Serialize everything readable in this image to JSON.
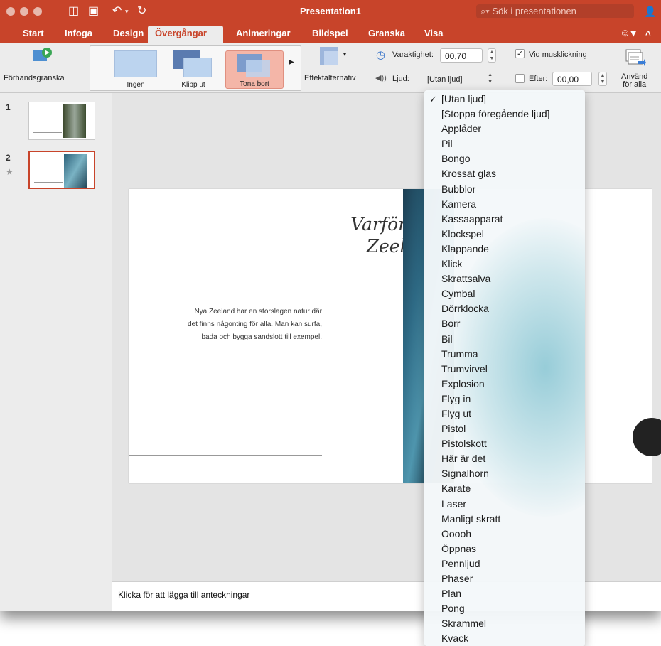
{
  "window": {
    "title": "Presentation1",
    "search_placeholder": "Sök i presentationen"
  },
  "tabs": [
    {
      "label": "Start"
    },
    {
      "label": "Infoga"
    },
    {
      "label": "Design"
    },
    {
      "label": "Övergångar",
      "active": true
    },
    {
      "label": "Animeringar"
    },
    {
      "label": "Bildspel"
    },
    {
      "label": "Granska"
    },
    {
      "label": "Visa"
    }
  ],
  "ribbon": {
    "preview_label": "Förhandsgranska",
    "transitions": [
      {
        "label": "Ingen"
      },
      {
        "label": "Klipp ut"
      },
      {
        "label": "Tona bort",
        "selected": true
      }
    ],
    "effect_options_label": "Effektalternativ",
    "duration_label": "Varaktighet:",
    "duration_value": "00,70",
    "sound_label": "Ljud:",
    "sound_value": "[Utan ljud]",
    "on_click_label": "Vid musklickning",
    "on_click_checked": true,
    "after_label": "Efter:",
    "after_value": "00,00",
    "after_checked": false,
    "apply_all_line1": "Använd",
    "apply_all_line2": "för alla"
  },
  "slides_pane": {
    "slides": [
      {
        "number": "1"
      },
      {
        "number": "2",
        "selected": true
      }
    ]
  },
  "slide": {
    "title_line1": "Varför Nya",
    "title_line2": "Zeeland?",
    "body_line1": "Nya Zeeland har en storslagen natur där",
    "body_line2": "det finns någonting för alla. Man kan surfa,",
    "body_line3": "bada och bygga sandslott till exempel."
  },
  "notes_placeholder": "Klicka för att lägga till anteckningar",
  "sound_menu": {
    "selected": "[Utan ljud]",
    "items": [
      "[Utan ljud]",
      "[Stoppa föregående ljud]",
      "Applåder",
      "Pil",
      "Bongo",
      "Krossat glas",
      "Bubblor",
      "Kamera",
      "Kassaapparat",
      "Klockspel",
      "Klappande",
      "Klick",
      "Skrattsalva",
      "Cymbal",
      "Dörrklocka",
      "Borr",
      "Bil",
      "Trumma",
      "Trumvirvel",
      "Explosion",
      "Flyg in",
      "Flyg ut",
      "Pistol",
      "Pistolskott",
      "Här är det",
      "Signalhorn",
      "Karate",
      "Laser",
      "Manligt skratt",
      "Ooooh",
      "Öppnas",
      "Pennljud",
      "Phaser",
      "Plan",
      "Pong",
      "Skrammel",
      "Kvack"
    ]
  },
  "colors": {
    "accent": "#c8442a",
    "ribbon_bg": "#ececec"
  }
}
